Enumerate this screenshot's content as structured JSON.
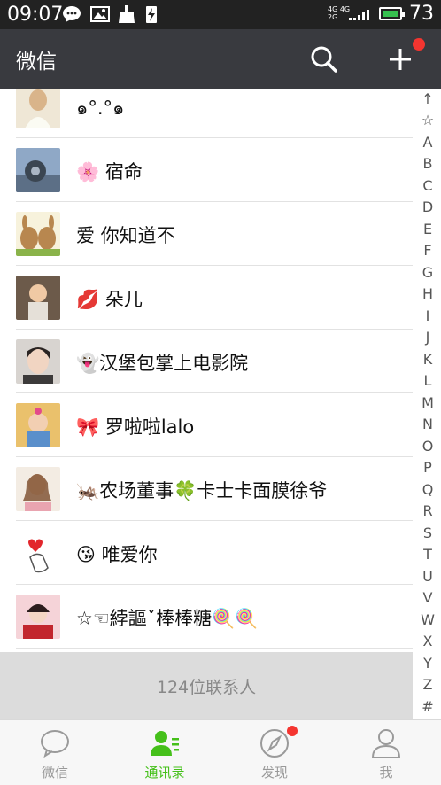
{
  "status_bar": {
    "time": "09:07",
    "network_top": "4G 4G",
    "network_bottom": "2G",
    "battery_percent": "73",
    "battery_level": 0.73
  },
  "app_bar": {
    "title": "微信",
    "search_icon": "search-icon",
    "plus_icon": "plus-icon"
  },
  "contacts": [
    {
      "name": "๑°.°๑",
      "avatar": "photo-girl-white"
    },
    {
      "name": "🌸 宿命",
      "avatar": "photo-motorcycle"
    },
    {
      "name": "爱 你知道不",
      "avatar": "cartoon-rabbits"
    },
    {
      "name": "💋  朵儿",
      "avatar": "photo-baby"
    },
    {
      "name": "👻汉堡包掌上电影院",
      "avatar": "photo-girl-selfie"
    },
    {
      "name": "🎀  罗啦啦lalo",
      "avatar": "photo-child-bow"
    },
    {
      "name": "🦗农场董事🍀卡士卡面膜徐爷",
      "avatar": "photo-woman"
    },
    {
      "name": "😘 唯爱你",
      "avatar": "hand-heart"
    },
    {
      "name": "☆☜綍謳ˇ棒棒糖🍭🍭",
      "avatar": "photo-girl-red"
    }
  ],
  "contact_count": "124位联系人",
  "index_letters": [
    "↑",
    "☆",
    "A",
    "B",
    "C",
    "D",
    "E",
    "F",
    "G",
    "H",
    "I",
    "J",
    "K",
    "L",
    "M",
    "N",
    "O",
    "P",
    "Q",
    "R",
    "S",
    "T",
    "U",
    "V",
    "W",
    "X",
    "Y",
    "Z",
    "#"
  ],
  "tabs": [
    {
      "label": "微信",
      "icon": "chat-bubble-icon",
      "active": false
    },
    {
      "label": "通讯录",
      "icon": "contacts-icon",
      "active": true
    },
    {
      "label": "发现",
      "icon": "compass-icon",
      "active": false
    },
    {
      "label": "我",
      "icon": "person-icon",
      "active": false
    }
  ],
  "colors": {
    "app_bar": "#393a3f",
    "active_tab": "#45c01a",
    "badge": "#f43530"
  }
}
